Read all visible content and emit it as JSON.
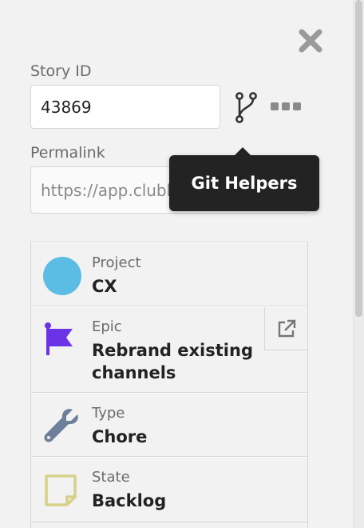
{
  "story_id": {
    "label": "Story ID",
    "value": "43869"
  },
  "permalink": {
    "label": "Permalink",
    "value": "https://app.clubhouse.io/story/43869"
  },
  "tooltip": {
    "text": "Git Helpers"
  },
  "icons": {
    "close": "close-icon",
    "git": "git-branch-icon",
    "more": "more-options-icon",
    "external": "external-link-icon"
  },
  "attributes": [
    {
      "key": "Project",
      "value": "CX",
      "icon": "project-circle-icon",
      "color": "#5bbde4"
    },
    {
      "key": "Epic",
      "value": "Rebrand existing channels",
      "icon": "epic-flag-icon",
      "color": "#6b33e6"
    },
    {
      "key": "Type",
      "value": "Chore",
      "icon": "wrench-icon",
      "color": "#6f7f99"
    },
    {
      "key": "State",
      "value": "Backlog",
      "icon": "backlog-state-icon",
      "color": "#d6d18a"
    }
  ]
}
